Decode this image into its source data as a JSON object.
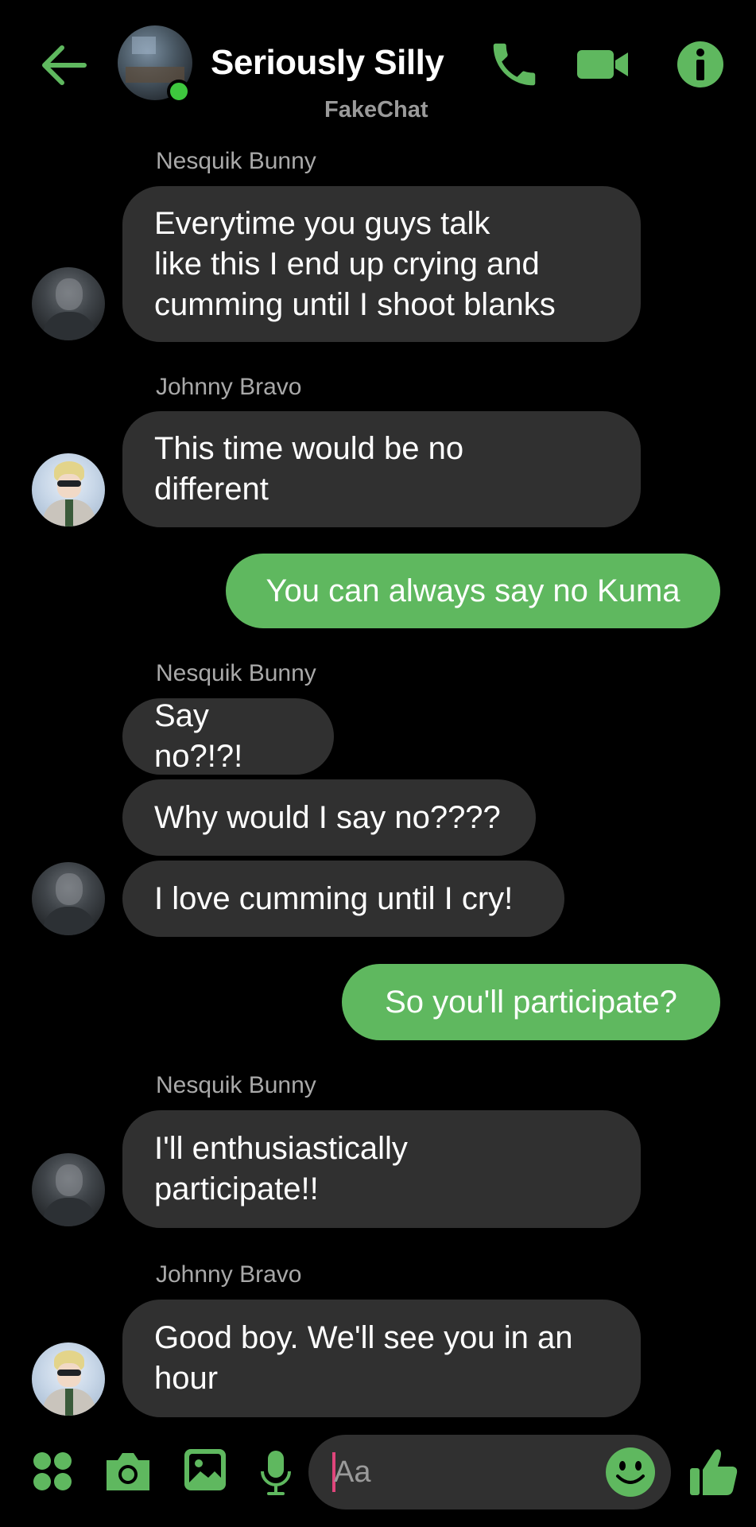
{
  "header": {
    "title": "Seriously Silly",
    "subtitle": "FakeChat"
  },
  "messages": [
    {
      "sender": "Nesquik Bunny",
      "text": "Everytime you guys talk\nlike this I end up crying and\ncumming until I shoot blanks"
    },
    {
      "sender": "Johnny Bravo",
      "text": "This time would be no\ndifferent"
    },
    {
      "sender": "me",
      "text": "You can always say no Kuma"
    },
    {
      "sender": "Nesquik Bunny",
      "text": "Say no?!?!"
    },
    {
      "sender": "Nesquik Bunny",
      "text": "Why would I say no????"
    },
    {
      "sender": "Nesquik Bunny",
      "text": "I love cumming until I cry!"
    },
    {
      "sender": "me",
      "text": "So you'll participate?"
    },
    {
      "sender": "Nesquik Bunny",
      "text": "I'll enthusiastically\nparticipate!!"
    },
    {
      "sender": "Johnny Bravo",
      "text": "Good boy.  We'll see you in an\nhour"
    }
  ],
  "composer": {
    "placeholder": "Aa"
  },
  "colors": {
    "accent": "#5fb85f",
    "bubble_incoming": "#303030",
    "background": "#000000",
    "online": "#3ec73e",
    "caret": "#e0457b"
  },
  "icons": [
    "back-arrow-icon",
    "phone-icon",
    "video-camera-icon",
    "info-icon",
    "apps-grid-icon",
    "camera-icon",
    "gallery-icon",
    "microphone-icon",
    "emoji-icon",
    "thumbs-up-icon"
  ]
}
